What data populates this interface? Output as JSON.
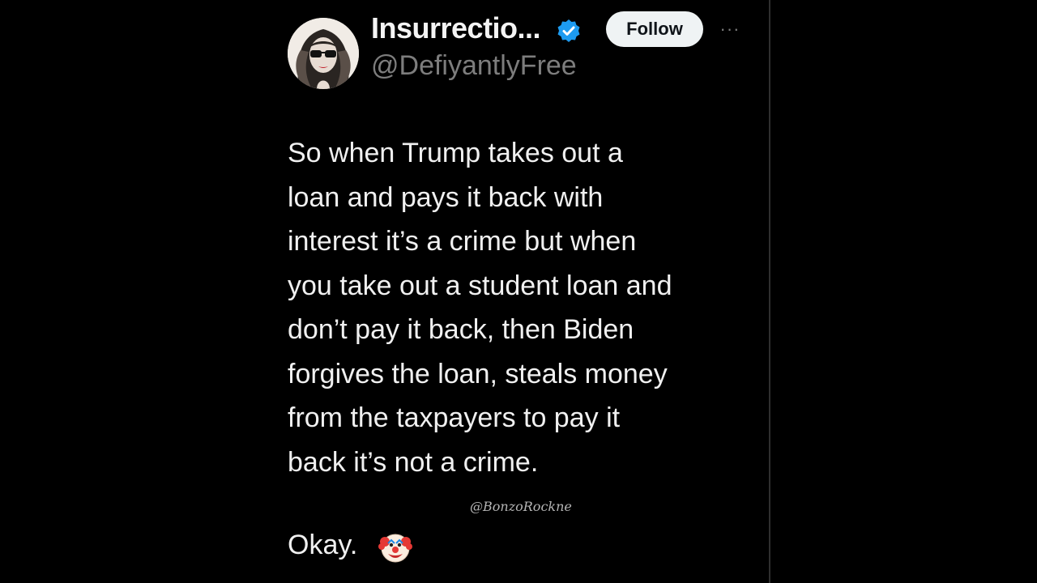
{
  "post": {
    "author": {
      "display_name": "Insurrectio...",
      "handle": "@DefiyantlyFree",
      "verified_icon": "verified-badge-icon",
      "avatar_icon": "avatar-woman-sunglasses"
    },
    "follow_label": "Follow",
    "more_icon": "more-horizontal-icon",
    "more_glyph": "···",
    "body_lines": [
      "So when Trump takes out a",
      "loan and pays it back with",
      "interest it’s a crime but when",
      "you take out a student loan and",
      "don’t pay it back, then Biden",
      "forgives the loan, steals money",
      "from the taxpayers to pay it",
      "back it’s not a crime."
    ],
    "closing_text": "Okay.",
    "closing_icon": "clown-face-icon",
    "watermark": "@BonzoRockne"
  },
  "colors": {
    "background": "#000000",
    "text": "#f0f0f0",
    "handle": "#7d7d7d",
    "verified": "#1d9bf0",
    "follow_bg": "#eff3f4"
  }
}
